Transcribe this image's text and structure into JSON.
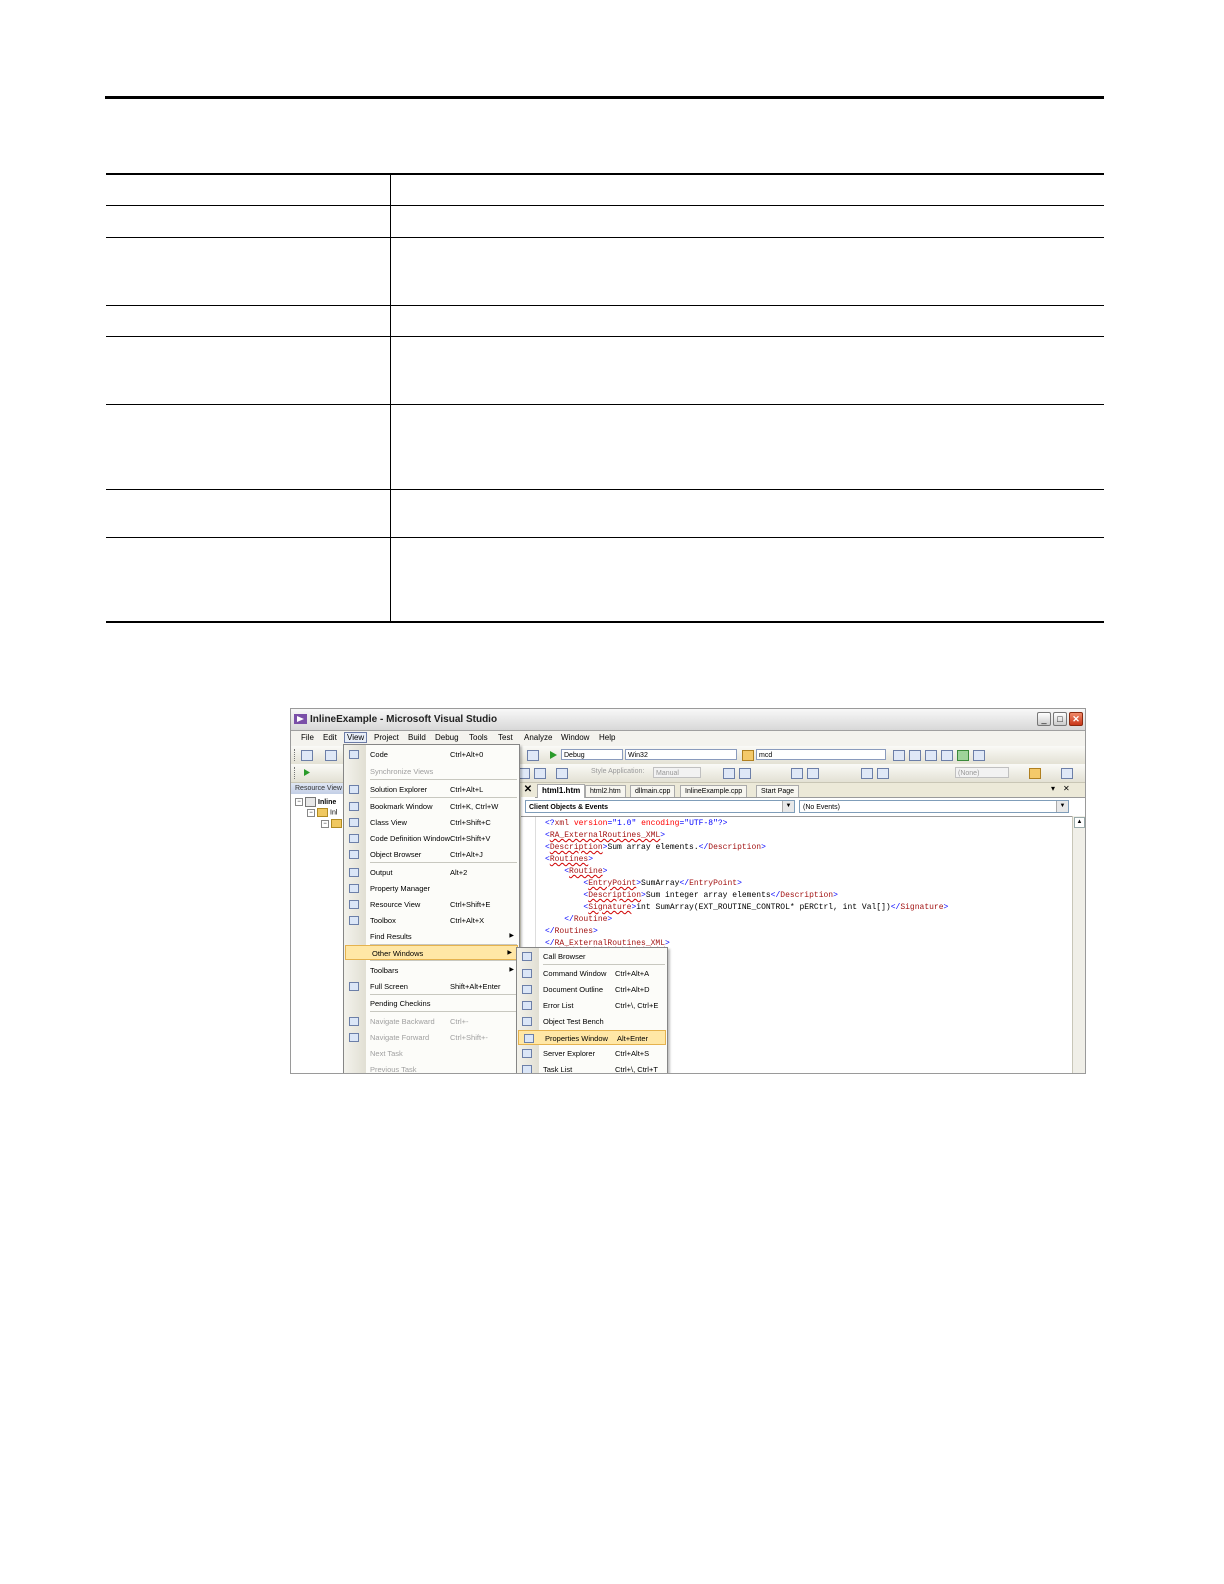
{
  "document": {
    "table_rows": 8
  },
  "screenshot": {
    "title": "InlineExample - Microsoft Visual Studio",
    "menubar": [
      "File",
      "Edit",
      "View",
      "Project",
      "Build",
      "Debug",
      "Tools",
      "Test",
      "Analyze",
      "Window",
      "Help"
    ],
    "toolbar1": {
      "config": "Debug",
      "platform": "Win32",
      "find": "mcd"
    },
    "toolbar2": {
      "style_label": "Style Application:",
      "style_value": "Manual",
      "target": "(None)"
    },
    "resource_view": {
      "header": "Resource View",
      "root": "Inline",
      "child": "Inl"
    },
    "tabs": [
      "html1.htm",
      "html2.htm",
      "dllmain.cpp",
      "InlineExample.cpp",
      "Start Page"
    ],
    "combo_left": "Client Objects & Events",
    "combo_right": "(No Events)",
    "code_lines": [
      "<?xml version=\"1.0\" encoding=\"UTF-8\"?>",
      "<RA_ExternalRoutines_XML>",
      "<Description>Sum array elements.</Description>",
      "<Routines>",
      "    <Routine>",
      "        <EntryPoint>SumArray</EntryPoint>",
      "        <Description>Sum integer array elements</Description>",
      "        <Signature>int SumArray(EXT_ROUTINE_CONTROL* pERCtrl, int Val[])</Signature>",
      "    </Routine>",
      "</Routines>",
      "</RA_ExternalRoutines_XML>"
    ],
    "view_menu": [
      {
        "label": "Code",
        "shortcut": "Ctrl+Alt+0"
      },
      {
        "label": "Synchronize Views",
        "shortcut": ""
      },
      {
        "label": "Solution Explorer",
        "shortcut": "Ctrl+Alt+L"
      },
      {
        "label": "Bookmark Window",
        "shortcut": "Ctrl+K, Ctrl+W"
      },
      {
        "label": "Class View",
        "shortcut": "Ctrl+Shift+C"
      },
      {
        "label": "Code Definition Window",
        "shortcut": "Ctrl+Shift+V"
      },
      {
        "label": "Object Browser",
        "shortcut": "Ctrl+Alt+J"
      },
      {
        "label": "Output",
        "shortcut": "Alt+2"
      },
      {
        "label": "Property Manager",
        "shortcut": ""
      },
      {
        "label": "Resource View",
        "shortcut": "Ctrl+Shift+E"
      },
      {
        "label": "Toolbox",
        "shortcut": "Ctrl+Alt+X"
      },
      {
        "label": "Find Results",
        "shortcut": ""
      },
      {
        "label": "Other Windows",
        "shortcut": ""
      },
      {
        "label": "Toolbars",
        "shortcut": ""
      },
      {
        "label": "Full Screen",
        "shortcut": "Shift+Alt+Enter"
      },
      {
        "label": "Pending Checkins",
        "shortcut": ""
      },
      {
        "label": "Navigate Backward",
        "shortcut": "Ctrl+-"
      },
      {
        "label": "Navigate Forward",
        "shortcut": "Ctrl+Shift+-"
      },
      {
        "label": "Next Task",
        "shortcut": ""
      },
      {
        "label": "Previous Task",
        "shortcut": ""
      }
    ],
    "other_windows_menu": [
      {
        "label": "Call Browser",
        "shortcut": ""
      },
      {
        "label": "Command Window",
        "shortcut": "Ctrl+Alt+A"
      },
      {
        "label": "Document Outline",
        "shortcut": "Ctrl+Alt+D"
      },
      {
        "label": "Error List",
        "shortcut": "Ctrl+\\, Ctrl+E"
      },
      {
        "label": "Object Test Bench",
        "shortcut": ""
      },
      {
        "label": "Properties Window",
        "shortcut": "Alt+Enter"
      },
      {
        "label": "Server Explorer",
        "shortcut": "Ctrl+Alt+S"
      },
      {
        "label": "Task List",
        "shortcut": "Ctrl+\\, Ctrl+T"
      }
    ]
  }
}
